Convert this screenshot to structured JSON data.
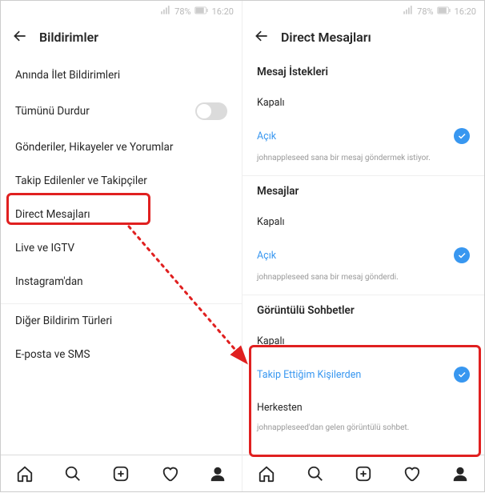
{
  "status": {
    "battery": "78%",
    "time": "16:20"
  },
  "left": {
    "title": "Bildirimler",
    "items": {
      "push": "Anında İlet Bildirimleri",
      "pause": "Tümünü Durdur",
      "posts": "Gönderiler, Hikayeler ve Yorumlar",
      "following": "Takip Edilenler ve Takipçiler",
      "direct": "Direct Mesajları",
      "live": "Live ve IGTV",
      "instagram": "Instagram'dan",
      "other": "Diğer Bildirim Türleri",
      "email": "E-posta ve SMS"
    }
  },
  "right": {
    "title": "Direct Mesajları",
    "sections": {
      "requests": {
        "title": "Mesaj İstekleri",
        "off": "Kapalı",
        "on": "Açık",
        "sub": "johnappleseed sana bir mesaj göndermek istiyor."
      },
      "messages": {
        "title": "Mesajlar",
        "off": "Kapalı",
        "on": "Açık",
        "sub": "johnappleseed sana bir mesaj gönderdi."
      },
      "video": {
        "title": "Görüntülü Sohbetler",
        "off": "Kapalı",
        "following": "Takip Ettiğim Kişilerden",
        "everyone": "Herkesten",
        "sub": "johnappleseed'dan gelen görüntülü sohbet."
      }
    }
  }
}
